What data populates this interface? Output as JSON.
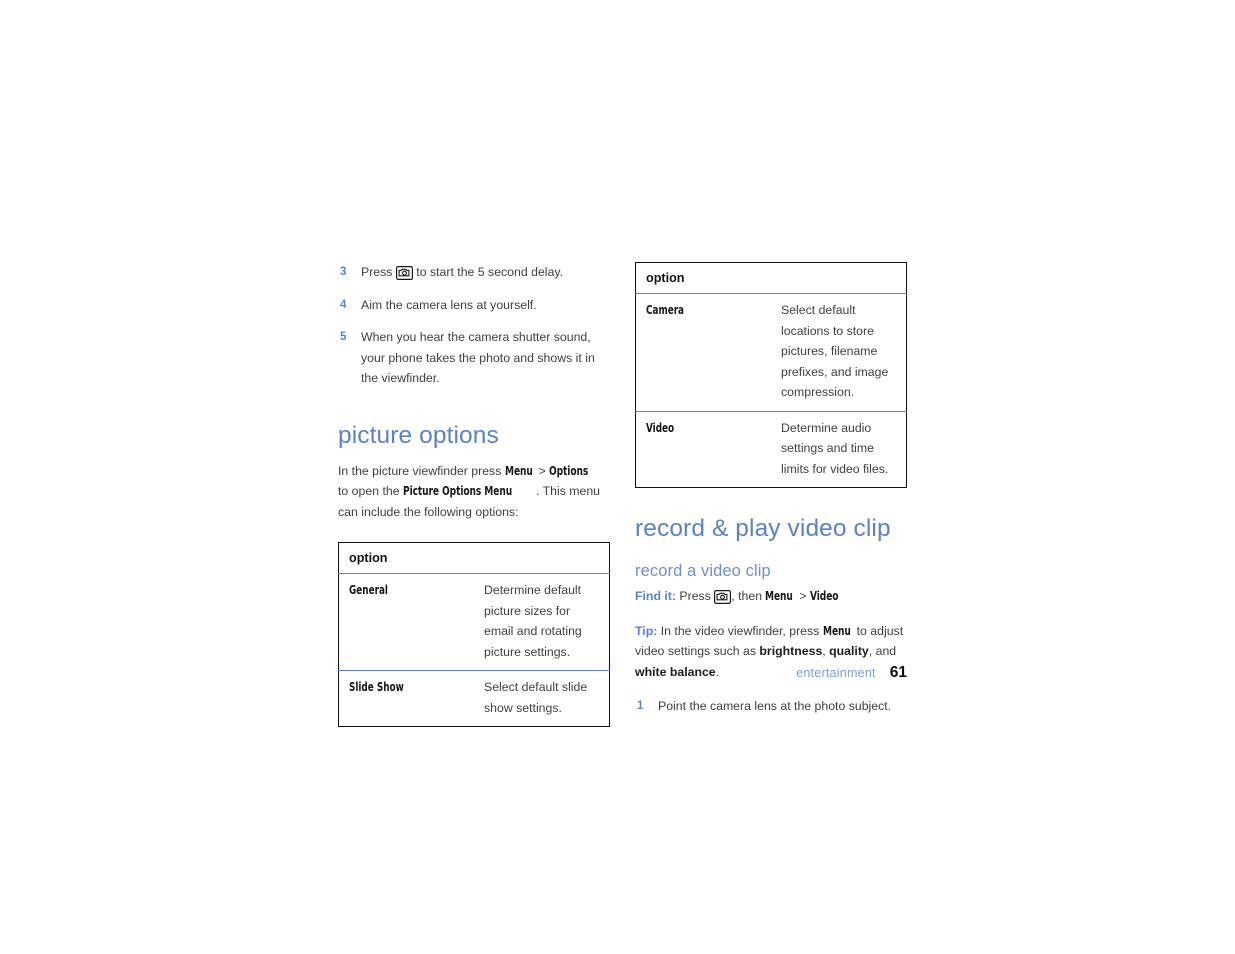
{
  "document": {
    "footer": {
      "section": "entertainment",
      "page_number": "61"
    }
  },
  "left_column": {
    "steps": [
      {
        "num": "3",
        "text_before": "Press",
        "icon": "camera-icon",
        "text_after": "to start the 5 second delay."
      },
      {
        "num": "4",
        "text": "Aim the camera lens at yourself."
      },
      {
        "num": "5",
        "text": "When you hear the camera shutter sound, your phone takes the photo and shows it in the viewfinder."
      }
    ],
    "section": {
      "heading": "picture options",
      "intro": {
        "p1": "In the picture viewfinder press",
        "ui1": "Menu",
        "gt": ">",
        "ui2": "Options",
        "p2": "to open the",
        "ui3": "Picture Options Menu",
        "p3": ". This menu can include the following options:"
      }
    },
    "table": {
      "header": "option",
      "rows": [
        {
          "key": "General",
          "value": "Determine default picture sizes for email and rotating picture settings."
        },
        {
          "key": "Slide Show",
          "value": "Select default slide show settings."
        }
      ]
    }
  },
  "right_column": {
    "table": {
      "header": "option",
      "rows": [
        {
          "key": "Camera",
          "value": "Select default locations to store pictures, filename prefixes, and image compression."
        },
        {
          "key": "Video",
          "value": "Determine audio settings and time limits for video files."
        }
      ]
    },
    "section": {
      "heading": "record & play video clip",
      "subheading": "record a video clip",
      "find_it": {
        "label": "Find it:",
        "press": "Press",
        "icon": "camera-icon",
        "then": ", then",
        "ui1": "Menu",
        "gt": ">",
        "ui2": "Video"
      },
      "tip": {
        "label": "Tip:",
        "p1": "In the video viewfinder, press",
        "ui1": "Menu",
        "p2": "to adjust video settings such as",
        "b1": "brightness",
        "comma1": ",",
        "b2": "quality",
        "comma2": ", and",
        "b3": "white balance",
        "period": "."
      },
      "steps": [
        {
          "num": "1",
          "text": "Point the camera lens at the photo subject."
        }
      ]
    }
  },
  "colors": {
    "accent_blue": "#5b82c8",
    "subheading_blue": "#6c8fd0",
    "footer_blue": "#7d9ed8",
    "body_text": "#3f3f3f",
    "table_border": "#101010"
  }
}
